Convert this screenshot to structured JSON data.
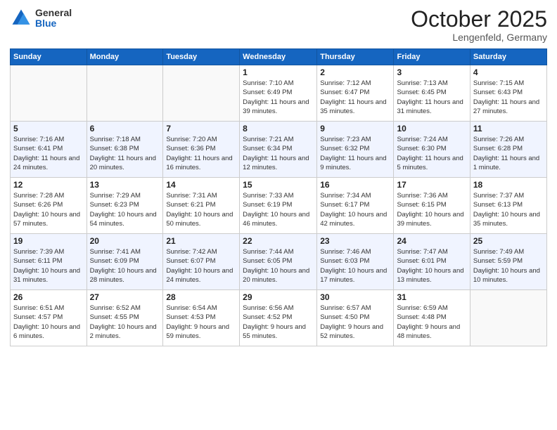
{
  "header": {
    "logo_general": "General",
    "logo_blue": "Blue",
    "title": "October 2025",
    "subtitle": "Lengenfeld, Germany"
  },
  "weekdays": [
    "Sunday",
    "Monday",
    "Tuesday",
    "Wednesday",
    "Thursday",
    "Friday",
    "Saturday"
  ],
  "weeks": [
    [
      {
        "day": "",
        "sunrise": "",
        "sunset": "",
        "daylight": ""
      },
      {
        "day": "",
        "sunrise": "",
        "sunset": "",
        "daylight": ""
      },
      {
        "day": "",
        "sunrise": "",
        "sunset": "",
        "daylight": ""
      },
      {
        "day": "1",
        "sunrise": "Sunrise: 7:10 AM",
        "sunset": "Sunset: 6:49 PM",
        "daylight": "Daylight: 11 hours and 39 minutes."
      },
      {
        "day": "2",
        "sunrise": "Sunrise: 7:12 AM",
        "sunset": "Sunset: 6:47 PM",
        "daylight": "Daylight: 11 hours and 35 minutes."
      },
      {
        "day": "3",
        "sunrise": "Sunrise: 7:13 AM",
        "sunset": "Sunset: 6:45 PM",
        "daylight": "Daylight: 11 hours and 31 minutes."
      },
      {
        "day": "4",
        "sunrise": "Sunrise: 7:15 AM",
        "sunset": "Sunset: 6:43 PM",
        "daylight": "Daylight: 11 hours and 27 minutes."
      }
    ],
    [
      {
        "day": "5",
        "sunrise": "Sunrise: 7:16 AM",
        "sunset": "Sunset: 6:41 PM",
        "daylight": "Daylight: 11 hours and 24 minutes."
      },
      {
        "day": "6",
        "sunrise": "Sunrise: 7:18 AM",
        "sunset": "Sunset: 6:38 PM",
        "daylight": "Daylight: 11 hours and 20 minutes."
      },
      {
        "day": "7",
        "sunrise": "Sunrise: 7:20 AM",
        "sunset": "Sunset: 6:36 PM",
        "daylight": "Daylight: 11 hours and 16 minutes."
      },
      {
        "day": "8",
        "sunrise": "Sunrise: 7:21 AM",
        "sunset": "Sunset: 6:34 PM",
        "daylight": "Daylight: 11 hours and 12 minutes."
      },
      {
        "day": "9",
        "sunrise": "Sunrise: 7:23 AM",
        "sunset": "Sunset: 6:32 PM",
        "daylight": "Daylight: 11 hours and 9 minutes."
      },
      {
        "day": "10",
        "sunrise": "Sunrise: 7:24 AM",
        "sunset": "Sunset: 6:30 PM",
        "daylight": "Daylight: 11 hours and 5 minutes."
      },
      {
        "day": "11",
        "sunrise": "Sunrise: 7:26 AM",
        "sunset": "Sunset: 6:28 PM",
        "daylight": "Daylight: 11 hours and 1 minute."
      }
    ],
    [
      {
        "day": "12",
        "sunrise": "Sunrise: 7:28 AM",
        "sunset": "Sunset: 6:26 PM",
        "daylight": "Daylight: 10 hours and 57 minutes."
      },
      {
        "day": "13",
        "sunrise": "Sunrise: 7:29 AM",
        "sunset": "Sunset: 6:23 PM",
        "daylight": "Daylight: 10 hours and 54 minutes."
      },
      {
        "day": "14",
        "sunrise": "Sunrise: 7:31 AM",
        "sunset": "Sunset: 6:21 PM",
        "daylight": "Daylight: 10 hours and 50 minutes."
      },
      {
        "day": "15",
        "sunrise": "Sunrise: 7:33 AM",
        "sunset": "Sunset: 6:19 PM",
        "daylight": "Daylight: 10 hours and 46 minutes."
      },
      {
        "day": "16",
        "sunrise": "Sunrise: 7:34 AM",
        "sunset": "Sunset: 6:17 PM",
        "daylight": "Daylight: 10 hours and 42 minutes."
      },
      {
        "day": "17",
        "sunrise": "Sunrise: 7:36 AM",
        "sunset": "Sunset: 6:15 PM",
        "daylight": "Daylight: 10 hours and 39 minutes."
      },
      {
        "day": "18",
        "sunrise": "Sunrise: 7:37 AM",
        "sunset": "Sunset: 6:13 PM",
        "daylight": "Daylight: 10 hours and 35 minutes."
      }
    ],
    [
      {
        "day": "19",
        "sunrise": "Sunrise: 7:39 AM",
        "sunset": "Sunset: 6:11 PM",
        "daylight": "Daylight: 10 hours and 31 minutes."
      },
      {
        "day": "20",
        "sunrise": "Sunrise: 7:41 AM",
        "sunset": "Sunset: 6:09 PM",
        "daylight": "Daylight: 10 hours and 28 minutes."
      },
      {
        "day": "21",
        "sunrise": "Sunrise: 7:42 AM",
        "sunset": "Sunset: 6:07 PM",
        "daylight": "Daylight: 10 hours and 24 minutes."
      },
      {
        "day": "22",
        "sunrise": "Sunrise: 7:44 AM",
        "sunset": "Sunset: 6:05 PM",
        "daylight": "Daylight: 10 hours and 20 minutes."
      },
      {
        "day": "23",
        "sunrise": "Sunrise: 7:46 AM",
        "sunset": "Sunset: 6:03 PM",
        "daylight": "Daylight: 10 hours and 17 minutes."
      },
      {
        "day": "24",
        "sunrise": "Sunrise: 7:47 AM",
        "sunset": "Sunset: 6:01 PM",
        "daylight": "Daylight: 10 hours and 13 minutes."
      },
      {
        "day": "25",
        "sunrise": "Sunrise: 7:49 AM",
        "sunset": "Sunset: 5:59 PM",
        "daylight": "Daylight: 10 hours and 10 minutes."
      }
    ],
    [
      {
        "day": "26",
        "sunrise": "Sunrise: 6:51 AM",
        "sunset": "Sunset: 4:57 PM",
        "daylight": "Daylight: 10 hours and 6 minutes."
      },
      {
        "day": "27",
        "sunrise": "Sunrise: 6:52 AM",
        "sunset": "Sunset: 4:55 PM",
        "daylight": "Daylight: 10 hours and 2 minutes."
      },
      {
        "day": "28",
        "sunrise": "Sunrise: 6:54 AM",
        "sunset": "Sunset: 4:53 PM",
        "daylight": "Daylight: 9 hours and 59 minutes."
      },
      {
        "day": "29",
        "sunrise": "Sunrise: 6:56 AM",
        "sunset": "Sunset: 4:52 PM",
        "daylight": "Daylight: 9 hours and 55 minutes."
      },
      {
        "day": "30",
        "sunrise": "Sunrise: 6:57 AM",
        "sunset": "Sunset: 4:50 PM",
        "daylight": "Daylight: 9 hours and 52 minutes."
      },
      {
        "day": "31",
        "sunrise": "Sunrise: 6:59 AM",
        "sunset": "Sunset: 4:48 PM",
        "daylight": "Daylight: 9 hours and 48 minutes."
      },
      {
        "day": "",
        "sunrise": "",
        "sunset": "",
        "daylight": ""
      }
    ]
  ]
}
